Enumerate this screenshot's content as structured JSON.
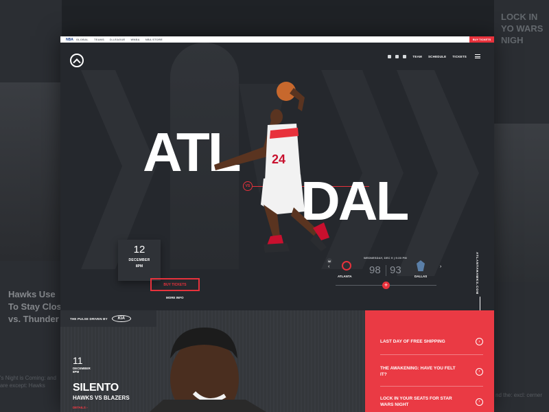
{
  "background": {
    "left_headline": "Hawks Use To Stay Clos vs. Thunder",
    "left_small": "'s Night is Coming: and are except: Hawks",
    "right_headline": "LOCK IN YO WARS NIGH",
    "right_small": "nd the: excl: cerner"
  },
  "topbar": {
    "brand": "NBA",
    "links": [
      "GLOBAL",
      "TEAMS",
      "D-LEAGUE",
      "WNBA",
      "NBA STORE"
    ],
    "buy_label": "BUY TICKETS"
  },
  "nav": {
    "social": [
      "instagram-icon",
      "twitter-icon",
      "facebook-icon"
    ],
    "links": [
      "TEAM",
      "SCHEDULE",
      "TICKETS"
    ]
  },
  "hero": {
    "home": "ATL",
    "away": "DAL",
    "vs": "VS",
    "date_day": "12",
    "date_month": "DECEMBER",
    "date_time": "8PM",
    "buy_label": "BUY TICKETS",
    "more_label": "MORE INFO",
    "site": "ATLANTAHAWKS.COM"
  },
  "score": {
    "result_badge": "W",
    "when": "WEDNESDAY, DEC 9  |  9:30 PM",
    "home_name": "ATLANTA",
    "home_score": "98",
    "away_name": "DALLAS",
    "away_score": "93",
    "prev": "‹",
    "next": "›",
    "plus": "+"
  },
  "feature": {
    "pulse_label": "THE PULSE DRIVEN BY",
    "sponsor": "KIA",
    "date_day": "11",
    "date_month": "DECEMBER",
    "date_time": "8PM",
    "title": "SILENTO",
    "subtitle": "HAWKS VS BLAZERS",
    "link": "DETAILS ›"
  },
  "news": [
    {
      "title": "LAST DAY OF FREE SHIPPING"
    },
    {
      "title": "THE AWAKENING: HAVE YOU FELT IT?"
    },
    {
      "title": "LOCK IN YOUR SEATS FOR STAR WARS NIGHT"
    }
  ],
  "colors": {
    "accent": "#e8323c",
    "dark": "#25282d",
    "news_bg": "#ea3a44"
  }
}
